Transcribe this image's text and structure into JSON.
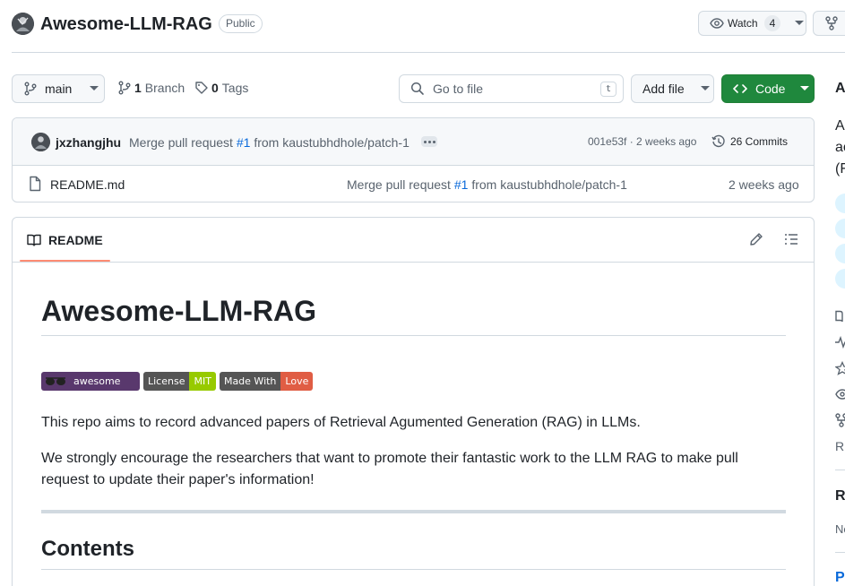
{
  "repo": {
    "name": "Awesome-LLM-RAG",
    "visibility": "Public"
  },
  "header_actions": {
    "watch_label": "Watch",
    "watch_count": "4"
  },
  "toolbar": {
    "branch_name": "main",
    "branch_count": "1",
    "branch_label": "Branch",
    "tag_count": "0",
    "tag_label": "Tags",
    "goto_file_placeholder": "Go to file",
    "goto_file_shortcut": "t",
    "add_file_label": "Add file",
    "code_label": "Code"
  },
  "latest_commit": {
    "author": "jxzhangjhu",
    "message_prefix": "Merge pull request",
    "pr_ref": "#1",
    "message_suffix": "from kaustubhdhole/patch-1",
    "hash_age": "001e53f · 2 weeks ago",
    "commits_label": "26 Commits"
  },
  "files": [
    {
      "name": "README.md",
      "message_prefix": "Merge pull request",
      "pr_ref": "#1",
      "message_suffix": "from kaustubhdhole/patch-1",
      "age": "2 weeks ago"
    }
  ],
  "readme": {
    "tab_label": "README",
    "title": "Awesome-LLM-RAG",
    "badges": [
      {
        "left": "",
        "right": "awesome",
        "color": "#59386d"
      },
      {
        "left": "License",
        "right": "MIT",
        "color": "#97ca00"
      },
      {
        "left": "Made With",
        "right": "Love",
        "color": "#e05d44"
      }
    ],
    "paragraph_1": "This repo aims to record advanced papers of Retrieval Agumented Generation (RAG) in LLMs.",
    "paragraph_2": "We strongly encourage the researchers that want to promote their fantastic work to the LLM RAG to make pull request to update their paper's information!",
    "contents_heading": "Contents"
  },
  "sidebar": {
    "about_initial": "A",
    "desc_lines": [
      "A",
      "ac",
      "(F"
    ],
    "readme_initial": "R",
    "releases_initial": "R",
    "no_releases_initial": "No",
    "packages_initial": "P"
  },
  "colors": {
    "accent_green": "#1f883d",
    "link_blue": "#0969da",
    "tab_underline": "#fd8c73",
    "border": "#d1d9e0"
  }
}
